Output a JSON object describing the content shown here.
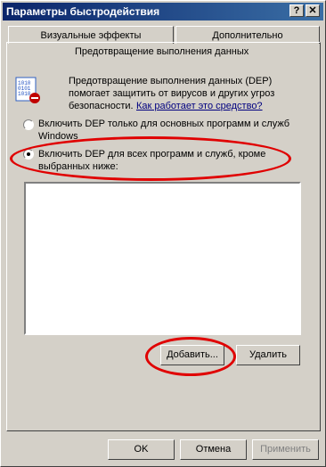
{
  "window": {
    "title": "Параметры быстродействия",
    "help_label": "?",
    "close_label": "✕"
  },
  "tabs": [
    {
      "label": "Визуальные эффекты"
    },
    {
      "label": "Дополнительно"
    }
  ],
  "panel": {
    "title": "Предотвращение выполнения данных",
    "icon_name": "dep-binary-shield-icon",
    "description_lines": [
      "Предотвращение выполнения данных (DEP)",
      "помогает защитить от вирусов и других угроз",
      "безопасности."
    ],
    "help_link": "Как работает это средство?",
    "option1_lines": [
      "Включить DEP только для основных программ и служб",
      "Windows"
    ],
    "option2_lines": [
      "Включить DEP для всех программ и служб, кроме",
      "выбранных ниже:"
    ],
    "selected_option": 2,
    "add_button": "Добавить...",
    "remove_button": "Удалить"
  },
  "footer": {
    "ok": "OK",
    "cancel": "Отмена",
    "apply": "Применить"
  },
  "highlight_color": "#e00000"
}
